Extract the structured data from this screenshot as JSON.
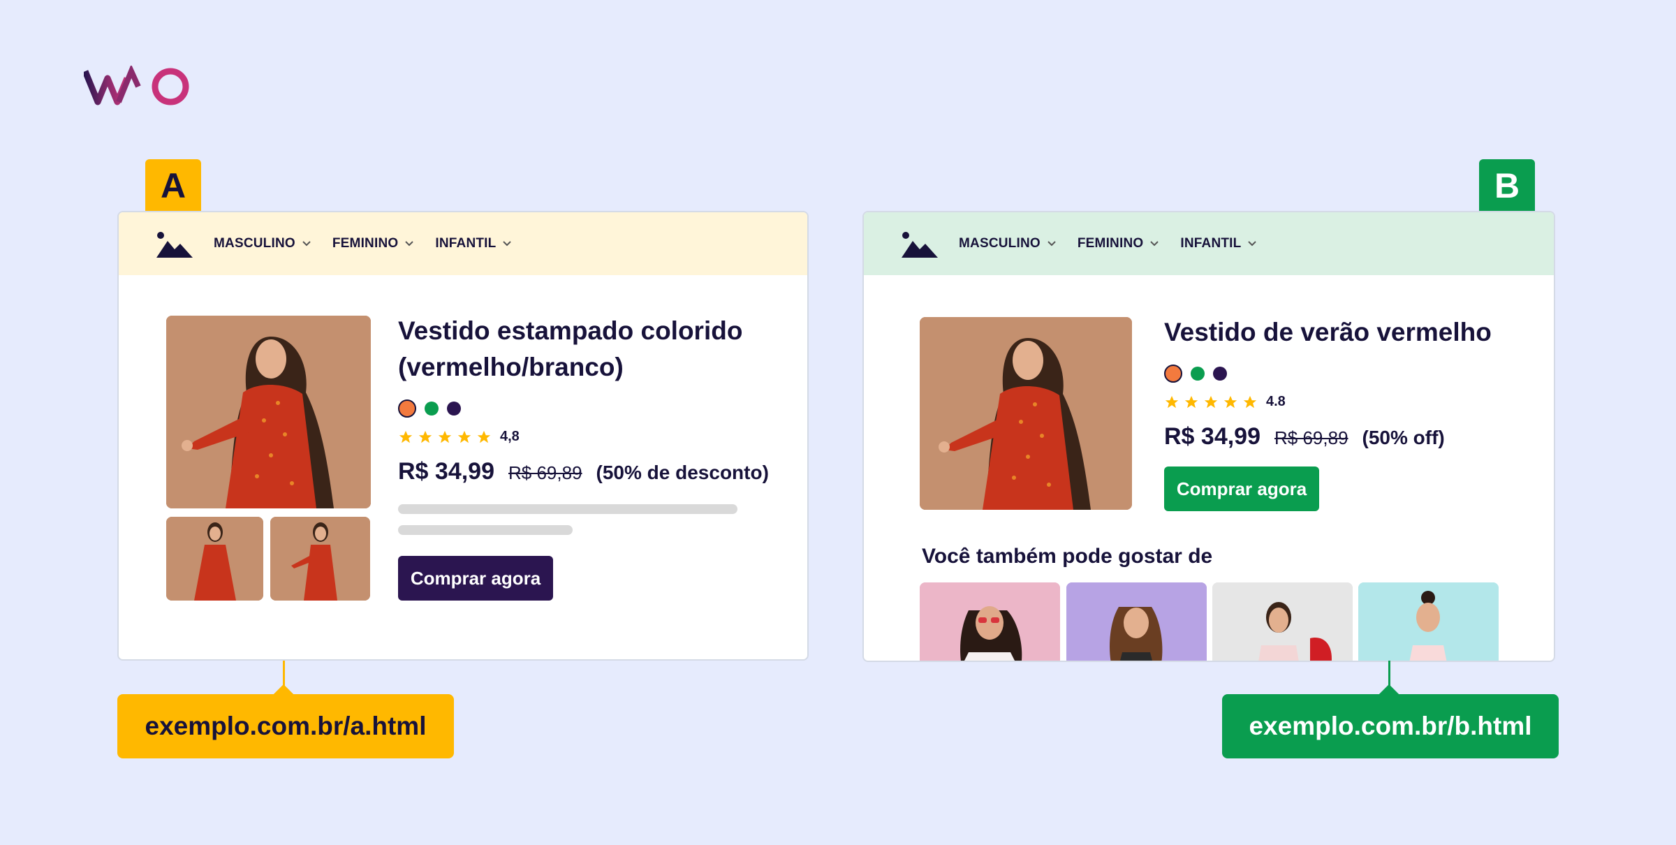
{
  "brand": {
    "logo_icon": "vwo-logo-icon"
  },
  "colors": {
    "background": "#e6ebfd",
    "variant_a": "#ffb800",
    "variant_b": "#0a9d4f",
    "dark": "#17123a",
    "buy_a": "#2b1550",
    "swatch_orange": "#f37a3e",
    "swatch_green": "#0a9d4f",
    "swatch_navy": "#2b1550",
    "star": "#ffb800"
  },
  "variant_a": {
    "tag": "A",
    "nav": {
      "logo_icon": "image-placeholder-icon",
      "items": [
        "MASCULINO",
        "FEMININO",
        "INFANTIL"
      ]
    },
    "product": {
      "title": "Vestido estampado colorido (vermelho/branco)",
      "rating": "4,8",
      "stars": 5,
      "price": "R$ 34,99",
      "old_price": "R$ 69,89",
      "discount": "(50% de desconto)",
      "buy_label": "Comprar agora"
    },
    "url": "exemplo.com.br/a.html"
  },
  "variant_b": {
    "tag": "B",
    "nav": {
      "logo_icon": "image-placeholder-icon",
      "items": [
        "MASCULINO",
        "FEMININO",
        "INFANTIL"
      ]
    },
    "product": {
      "title": "Vestido de verão vermelho",
      "rating": "4.8",
      "stars": 5,
      "price": "R$ 34,99",
      "old_price": "R$ 69,89",
      "discount": "(50% off)",
      "buy_label": "Comprar agora"
    },
    "recommendations_title": "Você também pode gostar de",
    "url": "exemplo.com.br/b.html"
  }
}
